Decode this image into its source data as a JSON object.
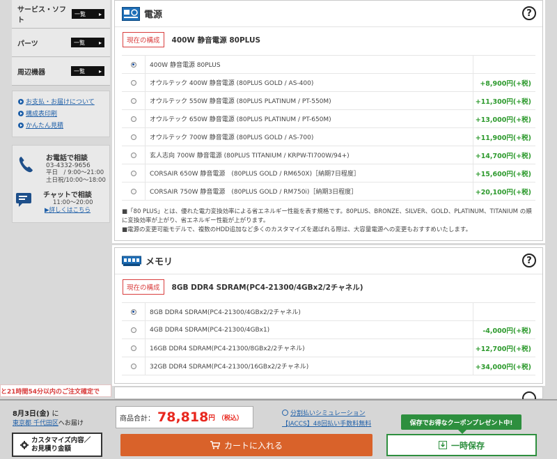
{
  "sidebar": {
    "nav": [
      {
        "label": "サービス・ソフト",
        "btn": "一覧"
      },
      {
        "label": "パーツ",
        "btn": "一覧"
      },
      {
        "label": "周辺機器",
        "btn": "一覧"
      }
    ],
    "links": [
      "お支払・お届けについて",
      "構成表印刷",
      "かんたん見積"
    ],
    "contact": {
      "phone_title": "お電話で相談",
      "phone_number": "03-4332-9656",
      "hours_weekday": "平日　/ 9:00〜21:00",
      "hours_weekend": "土日祝/10:00〜18:00",
      "chat_title": "チャットで相談",
      "chat_hours": "11:00〜20:00",
      "chat_link": "▶詳しくはこちら"
    }
  },
  "power": {
    "title": "電源",
    "current_tag": "現在の構成",
    "current_name": "400W 静音電源 80PLUS",
    "options": [
      {
        "label": "400W 静音電源 80PLUS",
        "price": "",
        "checked": true
      },
      {
        "label": "オウルテック 400W 静音電源 (80PLUS GOLD / AS-400)",
        "price": "+8,900円(+税)"
      },
      {
        "label": "オウルテック 550W 静音電源 (80PLUS PLATINUM / PT-550M)",
        "price": "+11,300円(+税)"
      },
      {
        "label": "オウルテック 650W 静音電源 (80PLUS PLATINUM / PT-650M)",
        "price": "+13,000円(+税)"
      },
      {
        "label": "オウルテック 700W 静音電源 (80PLUS GOLD / AS-700)",
        "price": "+11,900円(+税)"
      },
      {
        "label": "玄人志向 700W 静音電源 (80PLUS TITANIUM / KRPW-TI700W/94+)",
        "price": "+14,700円(+税)"
      },
      {
        "label": "CORSAIR 650W 静音電源　(80PLUS GOLD / RM650X)［納期7日程度］",
        "price": "+15,600円(+税)"
      },
      {
        "label": "CORSAIR 750W 静音電源　(80PLUS GOLD / RM750i)［納期3日程度］",
        "price": "+20,100円(+税)"
      }
    ],
    "note1": "■「80 PLUS」とは、優れた電力変換効率による省エネルギー性能を表す規格です。80PLUS、BRONZE、SILVER、GOLD、PLATINUM、TITANIUM の順に変換効率が上がり、省エネルギー性能が上がります。",
    "note2": "■電源の変更可能モデルで、複数のHDD追加など多くのカスタマイズを選ばれる際は、大容量電源への変更もおすすめいたします。"
  },
  "memory": {
    "title": "メモリ",
    "current_tag": "現在の構成",
    "current_name": "8GB DDR4 SDRAM(PC4-21300/4GBx2/2チャネル)",
    "options": [
      {
        "label": "8GB DDR4 SDRAM(PC4-21300/4GBx2/2チャネル)",
        "price": "",
        "checked": true
      },
      {
        "label": "4GB DDR4 SDRAM(PC4-21300/4GBx1)",
        "price": "-4,000円(+税)"
      },
      {
        "label": "16GB DDR4 SDRAM(PC4-21300/8GBx2/2チャネル)",
        "price": "+12,700円(+税)"
      },
      {
        "label": "32GB DDR4 SDRAM(PC4-21300/16GBx2/2チャネル)",
        "price": "+34,000円(+税)"
      }
    ]
  },
  "bottom": {
    "countdown": "と21時間54分以内のご注文確定で",
    "delivery_date": "8月3日(金)",
    "delivery_suffix": "に",
    "delivery_location": "東京都 千代田区",
    "delivery_location_suffix": "へお届け",
    "quote_btn_line1": "カスタマイズ内容／",
    "quote_btn_line2": "お見積り金額",
    "total_label": "商品合計：",
    "total_value": "78,818",
    "total_unit": "円",
    "total_tax": "（税込）",
    "split_link": "分割払いシミュレーション",
    "jaccs_link": "【JACCS】48回払い手数料無料",
    "cart_btn": "カートに入れる",
    "coupon_badge": "保存でお得なクーポンプレゼント中!",
    "save_btn": "一時保存"
  }
}
